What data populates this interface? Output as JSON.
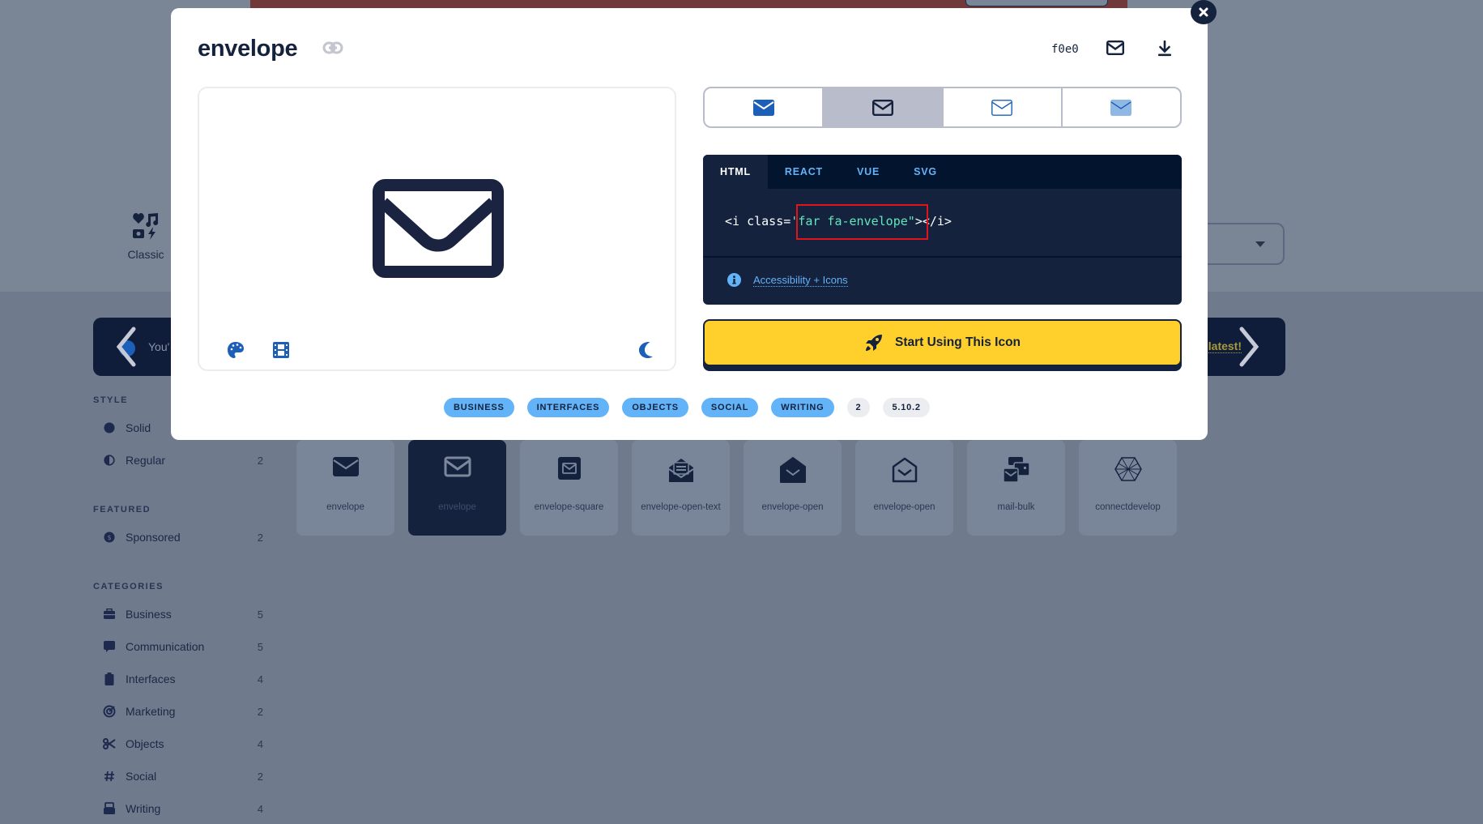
{
  "background": {
    "classic_tab": {
      "label": "Classic",
      "icon": "classic-icons-icon"
    },
    "banner": {
      "left_text": "You'",
      "right_link": "latest!",
      "prev_icon": "chevron-left-icon",
      "next_icon": "chevron-right-icon"
    },
    "sidebar": {
      "style_heading": "STYLE",
      "style_items": [
        {
          "label": "Solid",
          "count": "",
          "icon": "circle-solid-icon"
        },
        {
          "label": "Regular",
          "count": "2",
          "icon": "circle-half-icon"
        }
      ],
      "featured_heading": "FEATURED",
      "featured_items": [
        {
          "label": "Sponsored",
          "count": "2",
          "icon": "dollar-circle-icon"
        }
      ],
      "categories_heading": "CATEGORIES",
      "categories": [
        {
          "label": "Business",
          "count": "5",
          "icon": "briefcase-icon"
        },
        {
          "label": "Communication",
          "count": "5",
          "icon": "comment-icon"
        },
        {
          "label": "Interfaces",
          "count": "4",
          "icon": "clipboard-icon"
        },
        {
          "label": "Marketing",
          "count": "2",
          "icon": "bullseye-icon"
        },
        {
          "label": "Objects",
          "count": "4",
          "icon": "scissors-icon"
        },
        {
          "label": "Social",
          "count": "2",
          "icon": "hashtag-icon"
        },
        {
          "label": "Writing",
          "count": "4",
          "icon": "typewriter-icon"
        }
      ]
    },
    "results": [
      {
        "label": "envelope",
        "icon": "envelope-solid-icon",
        "selected": false
      },
      {
        "label": "envelope",
        "icon": "envelope-regular-icon",
        "selected": true
      },
      {
        "label": "envelope-square",
        "icon": "envelope-square-icon",
        "selected": false
      },
      {
        "label": "envelope-open-text",
        "icon": "envelope-open-text-icon",
        "selected": false
      },
      {
        "label": "envelope-open",
        "icon": "envelope-open-solid-icon",
        "selected": false
      },
      {
        "label": "envelope-open",
        "icon": "envelope-open-regular-icon",
        "selected": false
      },
      {
        "label": "mail-bulk",
        "icon": "mail-bulk-icon",
        "selected": false
      },
      {
        "label": "connectdevelop",
        "icon": "connectdevelop-icon",
        "selected": false
      }
    ]
  },
  "modal": {
    "title": "envelope",
    "unicode": "f0e0",
    "close_icon": "close-icon",
    "style_switcher": [
      {
        "name": "solid",
        "active": false
      },
      {
        "name": "regular",
        "active": true
      },
      {
        "name": "light",
        "active": false
      },
      {
        "name": "duotone",
        "active": false
      }
    ],
    "code": {
      "tabs": [
        "HTML",
        "REACT",
        "VUE",
        "SVG"
      ],
      "active_tab": "HTML",
      "prefix": "<i class=",
      "string_open": "'",
      "class_value": "far fa-envelope",
      "string_close": "\"",
      "suffix": "></i>",
      "a11y_link": "Accessibility + Icons"
    },
    "start_button": "Start Using This Icon",
    "tags": [
      "BUSINESS",
      "INTERFACES",
      "OBJECTS",
      "SOCIAL",
      "WRITING"
    ],
    "meta_badges": [
      "2",
      "5.10.2"
    ],
    "colors": {
      "navy": "#14223e",
      "accent_blue": "#1c5fb8",
      "light_blue": "#63b3f8",
      "yellow": "#ffd02b",
      "highlight_red": "#e3131b",
      "code_string": "#63e6be"
    }
  }
}
